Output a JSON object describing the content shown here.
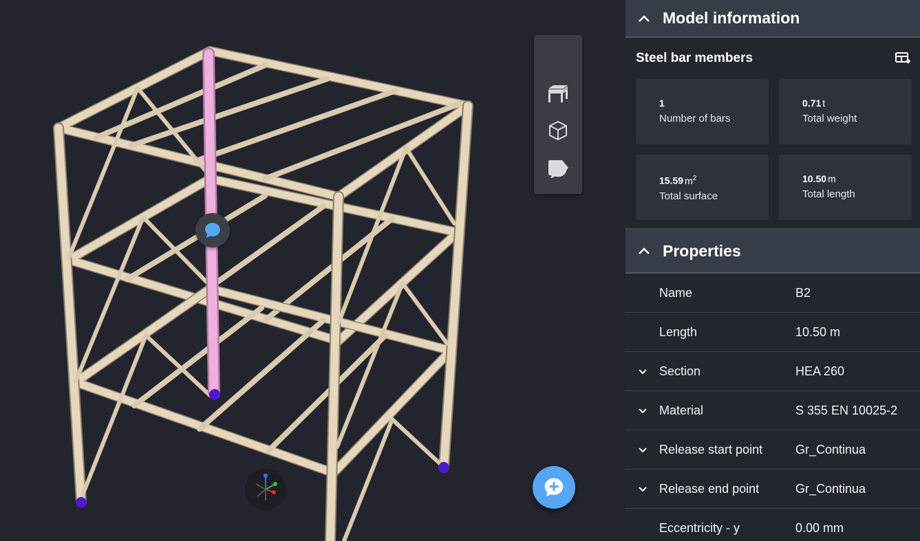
{
  "model_info": {
    "title": "Model information",
    "section_label": "Steel bar members",
    "cards": [
      {
        "value": "1",
        "unit": "",
        "label": "Number of bars"
      },
      {
        "value": "0.71",
        "unit": "t",
        "label": "Total weight"
      },
      {
        "value": "15.59",
        "unit": "m",
        "sup": "2",
        "label": "Total surface"
      },
      {
        "value": "10.50",
        "unit": "m",
        "label": "Total length"
      }
    ]
  },
  "properties": {
    "title": "Properties",
    "rows": [
      {
        "name": "Name",
        "value": "B2"
      },
      {
        "name": "Length",
        "value": "10.50 m"
      },
      {
        "name": "Section",
        "value": "HEA 260"
      },
      {
        "name": "Material",
        "value": "S 355 EN 10025-2"
      },
      {
        "name": "Release start point",
        "value": "Gr_Continua"
      },
      {
        "name": "Release end point",
        "value": "Gr_Continua"
      },
      {
        "name": "Eccentricity - y",
        "value": "0.00 mm"
      }
    ]
  },
  "toolbar": {
    "icons": [
      "structure-icon",
      "cube-icon",
      "tag-icon",
      "comment-icon"
    ]
  },
  "colors": {
    "sidebar_header": "#363d48",
    "card_bg": "#2d323b",
    "beam": "#e6d6bc",
    "highlight": "#e8a3d2",
    "support": "#4a1ad0",
    "fab": "#55a6f5"
  }
}
